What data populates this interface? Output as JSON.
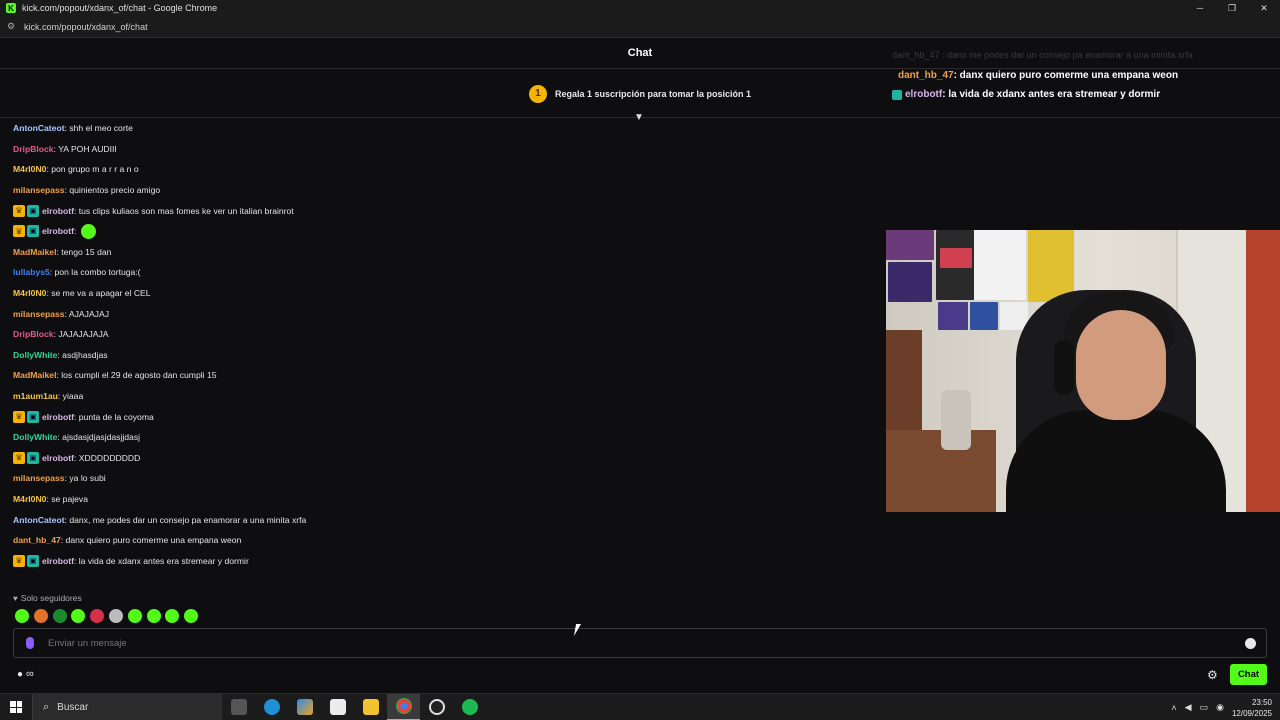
{
  "browser": {
    "window_title": "kick.com/popout/xdanx_of/chat - Google Chrome",
    "url": "kick.com/popout/xdanx_of/chat",
    "favicon_letter": "K"
  },
  "chat": {
    "header_title": "Chat",
    "pinned": {
      "badge_number": "1",
      "text": "Regala 1 suscripción para tomar la posición 1"
    }
  },
  "overlay": {
    "faded_line": "dant_hb_47 : danx me podes dar un consejo pa enamorar a una minita xrfa",
    "lines": [
      {
        "user": "dant_hb_47",
        "message": ": danx quiero puro comerme una empana weon"
      },
      {
        "user": "elrobotf",
        "message": ": la vida de xdanx antes era stremear y dormir"
      }
    ]
  },
  "messages": [
    {
      "user": "AntonCateot",
      "color": "#a9c4ff",
      "badges": [],
      "text": ": shh el meo corte"
    },
    {
      "user": "DripBlock",
      "color": "#e05c84",
      "badges": [],
      "text": ": YA POH AUDIII"
    },
    {
      "user": "M4rI0N0",
      "color": "#f5c542",
      "badges": [],
      "text": ": pon grupo m a r r a n o"
    },
    {
      "user": "milansepass",
      "color": "#f0a048",
      "badges": [],
      "text": ": quinientos precio amigo"
    },
    {
      "user": "elrobotf",
      "color": "#d5b7e8",
      "badges": [
        "crown",
        "bot"
      ],
      "text": ": tus clips kuliaos son mas fomes ke ver un italian brainrot"
    },
    {
      "user": "elrobotf",
      "color": "#d5b7e8",
      "badges": [
        "crown",
        "bot"
      ],
      "text": ":",
      "emote": true
    },
    {
      "user": "MadMaikel",
      "color": "#f0a048",
      "badges": [],
      "text": ": tengo 15 dan"
    },
    {
      "user": "lullabys5",
      "color": "#3b82f6",
      "badges": [],
      "text": ": pon la combo tortuga:("
    },
    {
      "user": "M4rI0N0",
      "color": "#f5c542",
      "badges": [],
      "text": ": se me va a apagar el CEL"
    },
    {
      "user": "milansepass",
      "color": "#f0a048",
      "badges": [],
      "text": ": AJAJAJAJ"
    },
    {
      "user": "DripBlock",
      "color": "#e05c84",
      "badges": [],
      "text": ": JAJAJAJAJA"
    },
    {
      "user": "DollyWhite",
      "color": "#34d399",
      "badges": [],
      "text": ": asdjhasdjas"
    },
    {
      "user": "MadMaikel",
      "color": "#f0a048",
      "badges": [],
      "text": ": los cumpli el 29 de agosto dan cumpli 15"
    },
    {
      "user": "m1aum1au",
      "color": "#f5c542",
      "badges": [],
      "text": ": yiaaa"
    },
    {
      "user": "elrobotf",
      "color": "#d5b7e8",
      "badges": [
        "crown",
        "bot"
      ],
      "text": ": punta de la coyoma"
    },
    {
      "user": "DollyWhite",
      "color": "#34d399",
      "badges": [],
      "text": ": ajsdasjdjasjdasjjdasj"
    },
    {
      "user": "elrobotf",
      "color": "#d5b7e8",
      "badges": [
        "crown",
        "bot"
      ],
      "text": ": XDDDDDDDDD"
    },
    {
      "user": "milansepass",
      "color": "#f0a048",
      "badges": [],
      "text": ": ya lo subi"
    },
    {
      "user": "M4rI0N0",
      "color": "#f5c542",
      "badges": [],
      "text": ": se pajeva"
    },
    {
      "user": "AntonCateot",
      "color": "#a9c4ff",
      "badges": [],
      "text": ": danx, me podes dar un consejo pa enamorar a una minita xrfa"
    },
    {
      "user": "dant_hb_47",
      "color": "#f0a048",
      "badges": [],
      "text": ": danx quiero puro comerme una empana weon"
    },
    {
      "user": "elrobotf",
      "color": "#d5b7e8",
      "badges": [
        "crown",
        "bot"
      ],
      "text": ": la vida de xdanx antes era stremear y dormir"
    }
  ],
  "footer": {
    "followers_only": "Solo seguidores",
    "input_placeholder": "Enviar un mensaje",
    "chat_button": "Chat",
    "infinity": "∞"
  },
  "taskbar": {
    "search_placeholder": "Buscar",
    "time": "23:50",
    "date": "12/09/2025"
  },
  "colors": {
    "accent": "#53fc18",
    "background": "#0e0e10"
  }
}
